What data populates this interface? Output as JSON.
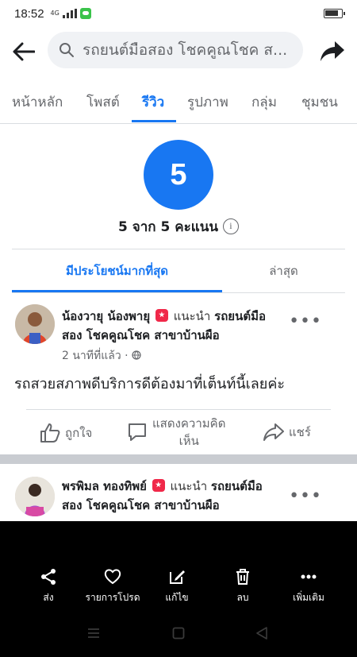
{
  "status": {
    "time": "18:52",
    "signal_label": "4G"
  },
  "header": {
    "search_text": "รถยนต์มือสอง โชคคูณโชค ส...",
    "back_icon": "back-arrow-icon",
    "share_icon": "share-arrow-icon"
  },
  "tabs": [
    {
      "label": "หน้าหลัก",
      "active": false
    },
    {
      "label": "โพสต์",
      "active": false
    },
    {
      "label": "รีวิว",
      "active": true
    },
    {
      "label": "รูปภาพ",
      "active": false
    },
    {
      "label": "กลุ่ม",
      "active": false
    },
    {
      "label": "ชุมชน",
      "active": false
    }
  ],
  "rating": {
    "score": "5",
    "summary": "5 จาก 5 คะแนน"
  },
  "sort_tabs": [
    {
      "label": "มีประโยชน์มากที่สุด",
      "active": true
    },
    {
      "label": "ล่าสุด",
      "active": false
    }
  ],
  "reviews": [
    {
      "name": "น้องวายุ น้องพายุ",
      "recommends": "แนะนำ",
      "page_line1": "รถยนต์มือ",
      "page_line2": "สอง โชคคูณโชค สาขาบ้านผือ",
      "time": "2 นาทีที่แล้ว ·",
      "body": "รถสวยสภาพดีบริการดีต้องมาที่เต็นท์นี้เลยค่ะ"
    },
    {
      "name": "พรพิมล ทองทิพย์",
      "recommends": "แนะนำ",
      "page_line1": "รถยนต์มือ",
      "page_line2": "สอง โชคคูณโชค สาขาบ้านผือ"
    }
  ],
  "review_actions": {
    "like": "ถูกใจ",
    "comment_line1": "แสดงความคิด",
    "comment_line2": "เห็น",
    "share": "แชร์"
  },
  "bottom_actions": [
    {
      "label": "ส่ง",
      "icon": "share-nodes-icon"
    },
    {
      "label": "รายการโปรด",
      "icon": "heart-icon"
    },
    {
      "label": "แก้ไข",
      "icon": "edit-icon"
    },
    {
      "label": "ลบ",
      "icon": "trash-icon"
    },
    {
      "label": "เพิ่มเติม",
      "icon": "more-icon"
    }
  ],
  "colors": {
    "accent": "#1877f2",
    "text": "#1c1e21",
    "secondary": "#65676b",
    "recommend": "#f02849"
  }
}
